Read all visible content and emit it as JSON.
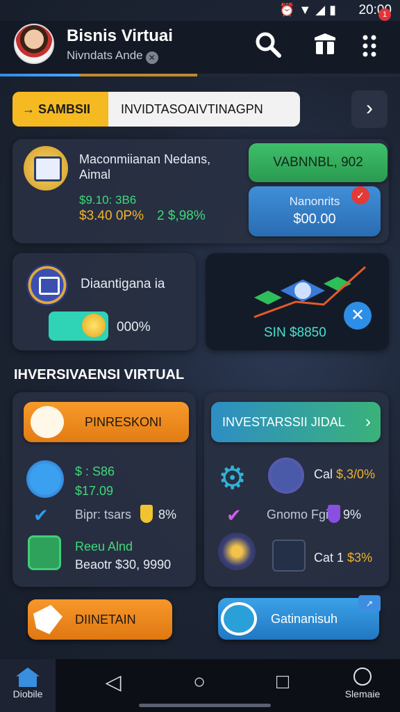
{
  "status_bar": {
    "time": "20:00",
    "icons": [
      "alarm-icon",
      "wifi-icon",
      "signal-icon",
      "battery-icon"
    ]
  },
  "header": {
    "title": "Bisnis Virtuai",
    "subtitle": "Nivndats Ande",
    "icons": [
      "search-icon",
      "box-icon",
      "menu-dots-icon"
    ],
    "badge": "1"
  },
  "search": {
    "tag_label": "→ SAMBSII",
    "value": "INVIDTASOAIVTINAGPN"
  },
  "summary_card": {
    "description": "Maconmiianan Nedans, Aimal",
    "value_green": "$9.10: 3B6",
    "value_yellow": "$3.40 0P%",
    "value_green2": "2 $,98%",
    "pill_green": "VABNNBL, 902",
    "pill_blue_line1": "Nanonrits",
    "pill_blue_line2": "$00.00"
  },
  "left_mini_card": {
    "label": "Diaantigana ia",
    "percent": "000%"
  },
  "right_mini_card": {
    "value": "SIN $8850"
  },
  "section_title": "IHVERSIVAENSI VIRTUAL",
  "left_panel": {
    "button": "PINRESKONI",
    "value1": "$  : S86",
    "value2": "$17.09",
    "value3": "Bipr: tsars",
    "percent": "8%",
    "value4": "Reeu Alnd",
    "value5": "Beaotr $30, 9990"
  },
  "right_panel": {
    "button": "INVESTARSSII JIDAL",
    "value1_prefix": "Cal",
    "value1_amount": "$,3/0%",
    "value2": "Gnomo Fgia",
    "percent": "9%",
    "value3_prefix": "Cat 1",
    "value3_amount": "$3%"
  },
  "bottom_buttons": {
    "left": "DIINETAIN",
    "right": "Gatinanisuh"
  },
  "nav": {
    "home_label": "Diobile",
    "right_label": "Slemaie"
  },
  "colors": {
    "accent_orange": "#f5a623",
    "accent_green": "#3fd97a",
    "accent_blue": "#2f8de0"
  }
}
